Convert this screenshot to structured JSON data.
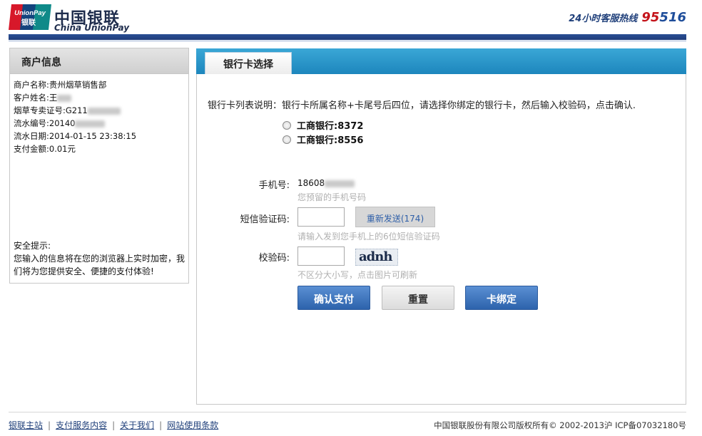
{
  "header": {
    "logo_cn": "中国银联",
    "logo_en": "China UnionPay",
    "logo_mark_text": "UnionPay",
    "logo_mark_cn": "银联",
    "hotline_label": "24小时客服热线",
    "hotline_prefix": "95",
    "hotline_suffix": "516",
    "colors": {
      "brand_blue": "#1f3c7a",
      "brand_red": "#c4141b",
      "tab_blue": "#2d95c9"
    }
  },
  "merchant": {
    "title": "商户信息",
    "rows": [
      {
        "label": "商户名称:",
        "value": "贵州烟草销售部"
      },
      {
        "label": "客户姓名:",
        "value": "王"
      },
      {
        "label": "烟草专卖证号:",
        "value": "G211"
      },
      {
        "label": "流水编号:",
        "value": "20140"
      },
      {
        "label": "流水日期:",
        "value": "2014-01-15 23:38:15"
      },
      {
        "label": "支付金额:",
        "value": "0.01元"
      }
    ],
    "security_title": "安全提示:",
    "security_text": "您输入的信息将在您的浏览器上实时加密，我们将为您提供安全、便捷的支付体验!"
  },
  "main": {
    "tab_label": "银行卡选择",
    "note": "银行卡列表说明：银行卡所属名称+卡尾号后四位，请选择你绑定的银行卡，然后输入校验码，点击确认.",
    "cards": [
      {
        "label": "工商银行:8372"
      },
      {
        "label": "工商银行:8556"
      }
    ],
    "phone_label": "手机号:",
    "phone_value": "18608",
    "phone_hint": "您预留的手机号码",
    "sms_label": "短信验证码:",
    "sms_value": "",
    "resend_label": "重新发送(174)",
    "sms_hint": "请输入发到您手机上的6位短信验证码",
    "verify_label": "校验码:",
    "verify_value": "",
    "captcha_text": "adnh",
    "verify_hint": "不区分大小写，点击图片可刷新",
    "confirm_label": "确认支付",
    "reset_label": "重置",
    "bind_label": "卡绑定"
  },
  "footer": {
    "links": [
      "银联主站",
      "支付服务内容",
      "关于我们",
      "网站使用条款"
    ],
    "copyright": "中国银联股份有限公司版权所有© 2002-2013沪 ICP备07032180号"
  }
}
